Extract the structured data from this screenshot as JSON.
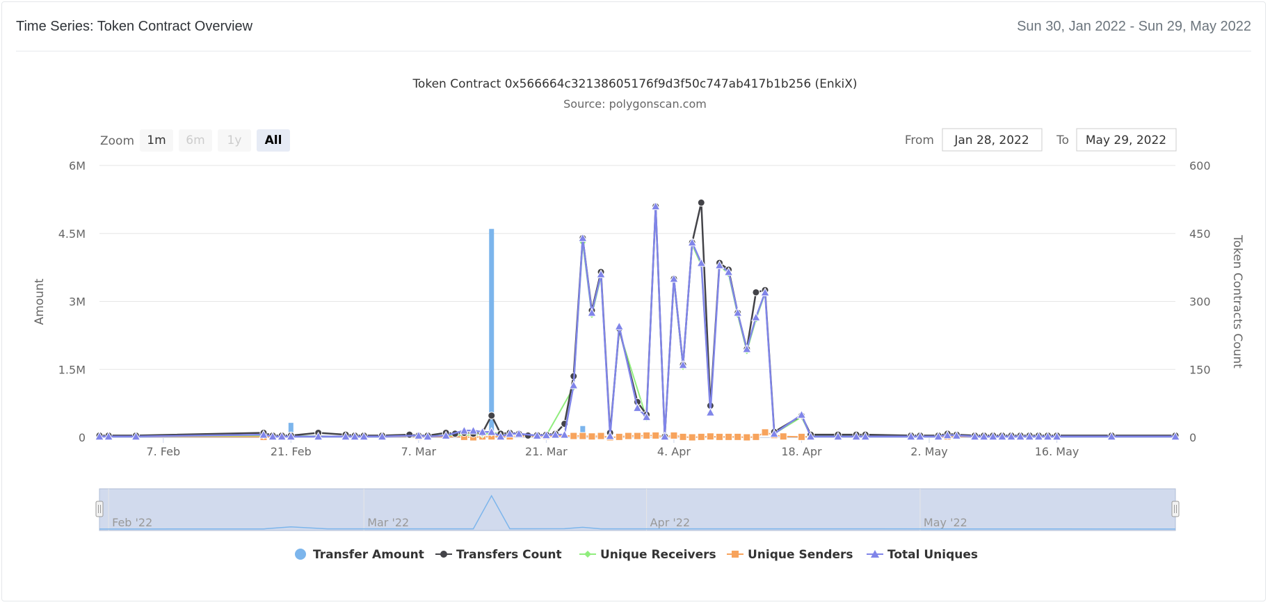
{
  "header": {
    "title": "Time Series: Token Contract Overview",
    "date_range": "Sun 30, Jan 2022 - Sun 29, May 2022"
  },
  "range_selector": {
    "zoom_label": "Zoom",
    "buttons": [
      {
        "label": "1m",
        "state": "enabled"
      },
      {
        "label": "6m",
        "state": "disabled"
      },
      {
        "label": "1y",
        "state": "disabled"
      },
      {
        "label": "All",
        "state": "selected"
      }
    ],
    "from_label": "From",
    "from_value": "Jan 28, 2022",
    "to_label": "To",
    "to_value": "May 29, 2022"
  },
  "navigator": {
    "labels": [
      "Feb '22",
      "Mar '22",
      "Apr '22",
      "May '22"
    ]
  },
  "colors": {
    "transfer_amount": "#7cb5ec",
    "transfers_count": "#434348",
    "unique_receivers": "#90ed7d",
    "unique_senders": "#f7a35c",
    "total_uniques": "#8085e9",
    "grid": "#e6e6e6",
    "navigator_fill": "#ccd6eb"
  },
  "chart_data": {
    "type": "line",
    "title": "Token Contract 0x566664c32138605176f9d3f50c747ab417b1b256 (EnkiX)",
    "subtitle": "Source: polygonscan.com",
    "x_axis": {
      "type": "datetime",
      "range": [
        "2022-01-31",
        "2022-05-29"
      ],
      "tick_labels": [
        "7. Feb",
        "21. Feb",
        "7. Mar",
        "21. Mar",
        "4. Apr",
        "18. Apr",
        "2. May",
        "16. May"
      ],
      "tick_dates": [
        "2022-02-07",
        "2022-02-21",
        "2022-03-07",
        "2022-03-21",
        "2022-04-04",
        "2022-04-18",
        "2022-05-02",
        "2022-05-16"
      ]
    },
    "y_axis_left": {
      "label": "Amount",
      "range": [
        0,
        6000000
      ],
      "tick_labels": [
        "0",
        "1.5M",
        "3M",
        "4.5M",
        "6M"
      ],
      "tick_values": [
        0,
        1500000,
        3000000,
        4500000,
        6000000
      ]
    },
    "y_axis_right": {
      "label": "Token Contracts Count",
      "range": [
        0,
        600
      ],
      "tick_labels": [
        "0",
        "150",
        "300",
        "450",
        "600"
      ],
      "tick_values": [
        0,
        150,
        300,
        450,
        600
      ]
    },
    "grid": true,
    "legend_position": "bottom",
    "series": [
      {
        "name": "Transfer Amount",
        "kind": "column",
        "axis": "left",
        "points": [
          [
            "2022-02-21",
            320000
          ],
          [
            "2022-03-15",
            4600000
          ],
          [
            "2022-03-25",
            250000
          ],
          [
            "2022-04-19",
            40000
          ]
        ]
      },
      {
        "name": "Transfers Count",
        "kind": "line",
        "axis": "right",
        "points": [
          [
            "2022-01-31",
            4
          ],
          [
            "2022-02-01",
            4
          ],
          [
            "2022-02-04",
            4
          ],
          [
            "2022-02-18",
            10
          ],
          [
            "2022-02-19",
            4
          ],
          [
            "2022-02-20",
            4
          ],
          [
            "2022-02-21",
            4
          ],
          [
            "2022-02-24",
            10
          ],
          [
            "2022-02-27",
            6
          ],
          [
            "2022-02-28",
            4
          ],
          [
            "2022-03-01",
            4
          ],
          [
            "2022-03-03",
            4
          ],
          [
            "2022-03-06",
            6
          ],
          [
            "2022-03-07",
            4
          ],
          [
            "2022-03-08",
            4
          ],
          [
            "2022-03-10",
            10
          ],
          [
            "2022-03-11",
            8
          ],
          [
            "2022-03-12",
            10
          ],
          [
            "2022-03-13",
            8
          ],
          [
            "2022-03-14",
            10
          ],
          [
            "2022-03-15",
            48
          ],
          [
            "2022-03-16",
            8
          ],
          [
            "2022-03-17",
            10
          ],
          [
            "2022-03-18",
            8
          ],
          [
            "2022-03-19",
            4
          ],
          [
            "2022-03-20",
            5
          ],
          [
            "2022-03-21",
            6
          ],
          [
            "2022-03-22",
            8
          ],
          [
            "2022-03-23",
            30
          ],
          [
            "2022-03-24",
            135
          ],
          [
            "2022-03-25",
            440
          ],
          [
            "2022-03-26",
            280
          ],
          [
            "2022-03-27",
            365
          ],
          [
            "2022-03-28",
            10
          ],
          [
            "2022-03-29",
            240
          ],
          [
            "2022-03-31",
            78
          ],
          [
            "2022-04-01",
            50
          ],
          [
            "2022-04-02",
            510
          ],
          [
            "2022-04-03",
            2
          ],
          [
            "2022-04-04",
            350
          ],
          [
            "2022-04-05",
            160
          ],
          [
            "2022-04-06",
            430
          ],
          [
            "2022-04-07",
            518
          ],
          [
            "2022-04-08",
            70
          ],
          [
            "2022-04-09",
            385
          ],
          [
            "2022-04-10",
            370
          ],
          [
            "2022-04-11",
            275
          ],
          [
            "2022-04-12",
            195
          ],
          [
            "2022-04-13",
            320
          ],
          [
            "2022-04-14",
            325
          ],
          [
            "2022-04-15",
            12
          ],
          [
            "2022-04-18",
            48
          ],
          [
            "2022-04-19",
            6
          ],
          [
            "2022-04-22",
            6
          ],
          [
            "2022-04-24",
            6
          ],
          [
            "2022-04-25",
            6
          ],
          [
            "2022-04-30",
            4
          ],
          [
            "2022-05-01",
            4
          ],
          [
            "2022-05-03",
            4
          ],
          [
            "2022-05-04",
            8
          ],
          [
            "2022-05-05",
            6
          ],
          [
            "2022-05-07",
            4
          ],
          [
            "2022-05-08",
            4
          ],
          [
            "2022-05-09",
            4
          ],
          [
            "2022-05-10",
            4
          ],
          [
            "2022-05-11",
            4
          ],
          [
            "2022-05-12",
            4
          ],
          [
            "2022-05-13",
            4
          ],
          [
            "2022-05-14",
            4
          ],
          [
            "2022-05-15",
            4
          ],
          [
            "2022-05-16",
            4
          ],
          [
            "2022-05-22",
            4
          ],
          [
            "2022-05-29",
            4
          ]
        ]
      },
      {
        "name": "Unique Receivers",
        "kind": "line",
        "axis": "right",
        "points": [
          [
            "2022-01-31",
            2
          ],
          [
            "2022-02-04",
            2
          ],
          [
            "2022-02-18",
            4
          ],
          [
            "2022-02-21",
            3
          ],
          [
            "2022-02-28",
            2
          ],
          [
            "2022-03-07",
            3
          ],
          [
            "2022-03-14",
            6
          ],
          [
            "2022-03-15",
            10
          ],
          [
            "2022-03-21",
            4
          ],
          [
            "2022-03-24",
            110
          ],
          [
            "2022-03-25",
            430
          ],
          [
            "2022-03-26",
            270
          ],
          [
            "2022-03-27",
            355
          ],
          [
            "2022-03-28",
            5
          ],
          [
            "2022-03-29",
            235
          ],
          [
            "2022-04-01",
            42
          ],
          [
            "2022-04-02",
            505
          ],
          [
            "2022-04-03",
            2
          ],
          [
            "2022-04-04",
            345
          ],
          [
            "2022-04-05",
            155
          ],
          [
            "2022-04-06",
            425
          ],
          [
            "2022-04-07",
            380
          ],
          [
            "2022-04-08",
            55
          ],
          [
            "2022-04-09",
            380
          ],
          [
            "2022-04-10",
            360
          ],
          [
            "2022-04-11",
            270
          ],
          [
            "2022-04-12",
            190
          ],
          [
            "2022-04-13",
            260
          ],
          [
            "2022-04-14",
            318
          ],
          [
            "2022-04-15",
            8
          ],
          [
            "2022-04-18",
            45
          ],
          [
            "2022-04-19",
            3
          ],
          [
            "2022-04-25",
            3
          ],
          [
            "2022-05-04",
            4
          ],
          [
            "2022-05-16",
            2
          ],
          [
            "2022-05-29",
            2
          ]
        ]
      },
      {
        "name": "Unique Senders",
        "kind": "line",
        "axis": "right",
        "points": [
          [
            "2022-01-31",
            1
          ],
          [
            "2022-02-01",
            2
          ],
          [
            "2022-02-04",
            2
          ],
          [
            "2022-02-18",
            1
          ],
          [
            "2022-02-20",
            2
          ],
          [
            "2022-02-24",
            2
          ],
          [
            "2022-02-27",
            2
          ],
          [
            "2022-03-01",
            2
          ],
          [
            "2022-03-07",
            2
          ],
          [
            "2022-03-12",
            1
          ],
          [
            "2022-03-13",
            0
          ],
          [
            "2022-03-14",
            2
          ],
          [
            "2022-03-15",
            2
          ],
          [
            "2022-03-17",
            2
          ],
          [
            "2022-03-21",
            3
          ],
          [
            "2022-03-24",
            3
          ],
          [
            "2022-03-25",
            3
          ],
          [
            "2022-03-26",
            2
          ],
          [
            "2022-03-27",
            3
          ],
          [
            "2022-03-28",
            0
          ],
          [
            "2022-03-29",
            1
          ],
          [
            "2022-03-30",
            3
          ],
          [
            "2022-03-31",
            3
          ],
          [
            "2022-04-01",
            4
          ],
          [
            "2022-04-02",
            4
          ],
          [
            "2022-04-03",
            1
          ],
          [
            "2022-04-04",
            4
          ],
          [
            "2022-04-05",
            1
          ],
          [
            "2022-04-06",
            0
          ],
          [
            "2022-04-07",
            1
          ],
          [
            "2022-04-08",
            2
          ],
          [
            "2022-04-09",
            1
          ],
          [
            "2022-04-10",
            1
          ],
          [
            "2022-04-11",
            1
          ],
          [
            "2022-04-12",
            0
          ],
          [
            "2022-04-13",
            1
          ],
          [
            "2022-04-14",
            11
          ],
          [
            "2022-04-15",
            5
          ],
          [
            "2022-04-16",
            2
          ],
          [
            "2022-04-18",
            1
          ],
          [
            "2022-04-19",
            2
          ],
          [
            "2022-04-22",
            2
          ],
          [
            "2022-04-24",
            2
          ],
          [
            "2022-04-25",
            2
          ],
          [
            "2022-05-01",
            2
          ],
          [
            "2022-05-04",
            2
          ],
          [
            "2022-05-07",
            2
          ],
          [
            "2022-05-10",
            2
          ],
          [
            "2022-05-12",
            2
          ],
          [
            "2022-05-16",
            2
          ],
          [
            "2022-05-22",
            2
          ],
          [
            "2022-05-29",
            2
          ]
        ]
      },
      {
        "name": "Total Uniques",
        "kind": "line",
        "axis": "right",
        "points": [
          [
            "2022-01-31",
            2
          ],
          [
            "2022-02-01",
            2
          ],
          [
            "2022-02-04",
            2
          ],
          [
            "2022-02-18",
            6
          ],
          [
            "2022-02-19",
            2
          ],
          [
            "2022-02-20",
            2
          ],
          [
            "2022-02-21",
            2
          ],
          [
            "2022-02-24",
            2
          ],
          [
            "2022-02-27",
            2
          ],
          [
            "2022-02-28",
            2
          ],
          [
            "2022-03-01",
            2
          ],
          [
            "2022-03-03",
            2
          ],
          [
            "2022-03-07",
            4
          ],
          [
            "2022-03-08",
            2
          ],
          [
            "2022-03-10",
            4
          ],
          [
            "2022-03-12",
            15
          ],
          [
            "2022-03-13",
            15
          ],
          [
            "2022-03-14",
            12
          ],
          [
            "2022-03-15",
            12
          ],
          [
            "2022-03-16",
            2
          ],
          [
            "2022-03-17",
            8
          ],
          [
            "2022-03-18",
            8
          ],
          [
            "2022-03-20",
            4
          ],
          [
            "2022-03-21",
            5
          ],
          [
            "2022-03-22",
            6
          ],
          [
            "2022-03-23",
            6
          ],
          [
            "2022-03-24",
            115
          ],
          [
            "2022-03-25",
            440
          ],
          [
            "2022-03-26",
            275
          ],
          [
            "2022-03-27",
            360
          ],
          [
            "2022-03-28",
            3
          ],
          [
            "2022-03-29",
            245
          ],
          [
            "2022-03-31",
            65
          ],
          [
            "2022-04-01",
            45
          ],
          [
            "2022-04-02",
            510
          ],
          [
            "2022-04-03",
            2
          ],
          [
            "2022-04-04",
            350
          ],
          [
            "2022-04-05",
            160
          ],
          [
            "2022-04-06",
            430
          ],
          [
            "2022-04-07",
            385
          ],
          [
            "2022-04-08",
            55
          ],
          [
            "2022-04-09",
            380
          ],
          [
            "2022-04-10",
            365
          ],
          [
            "2022-04-11",
            275
          ],
          [
            "2022-04-12",
            195
          ],
          [
            "2022-04-13",
            265
          ],
          [
            "2022-04-14",
            320
          ],
          [
            "2022-04-15",
            8
          ],
          [
            "2022-04-18",
            50
          ],
          [
            "2022-04-19",
            2
          ],
          [
            "2022-04-22",
            2
          ],
          [
            "2022-04-24",
            2
          ],
          [
            "2022-04-25",
            2
          ],
          [
            "2022-04-30",
            2
          ],
          [
            "2022-05-01",
            2
          ],
          [
            "2022-05-03",
            2
          ],
          [
            "2022-05-04",
            5
          ],
          [
            "2022-05-05",
            4
          ],
          [
            "2022-05-07",
            2
          ],
          [
            "2022-05-08",
            2
          ],
          [
            "2022-05-09",
            2
          ],
          [
            "2022-05-10",
            2
          ],
          [
            "2022-05-11",
            2
          ],
          [
            "2022-05-12",
            2
          ],
          [
            "2022-05-13",
            2
          ],
          [
            "2022-05-14",
            2
          ],
          [
            "2022-05-15",
            2
          ],
          [
            "2022-05-16",
            2
          ],
          [
            "2022-05-22",
            2
          ],
          [
            "2022-05-29",
            2
          ]
        ]
      }
    ]
  }
}
